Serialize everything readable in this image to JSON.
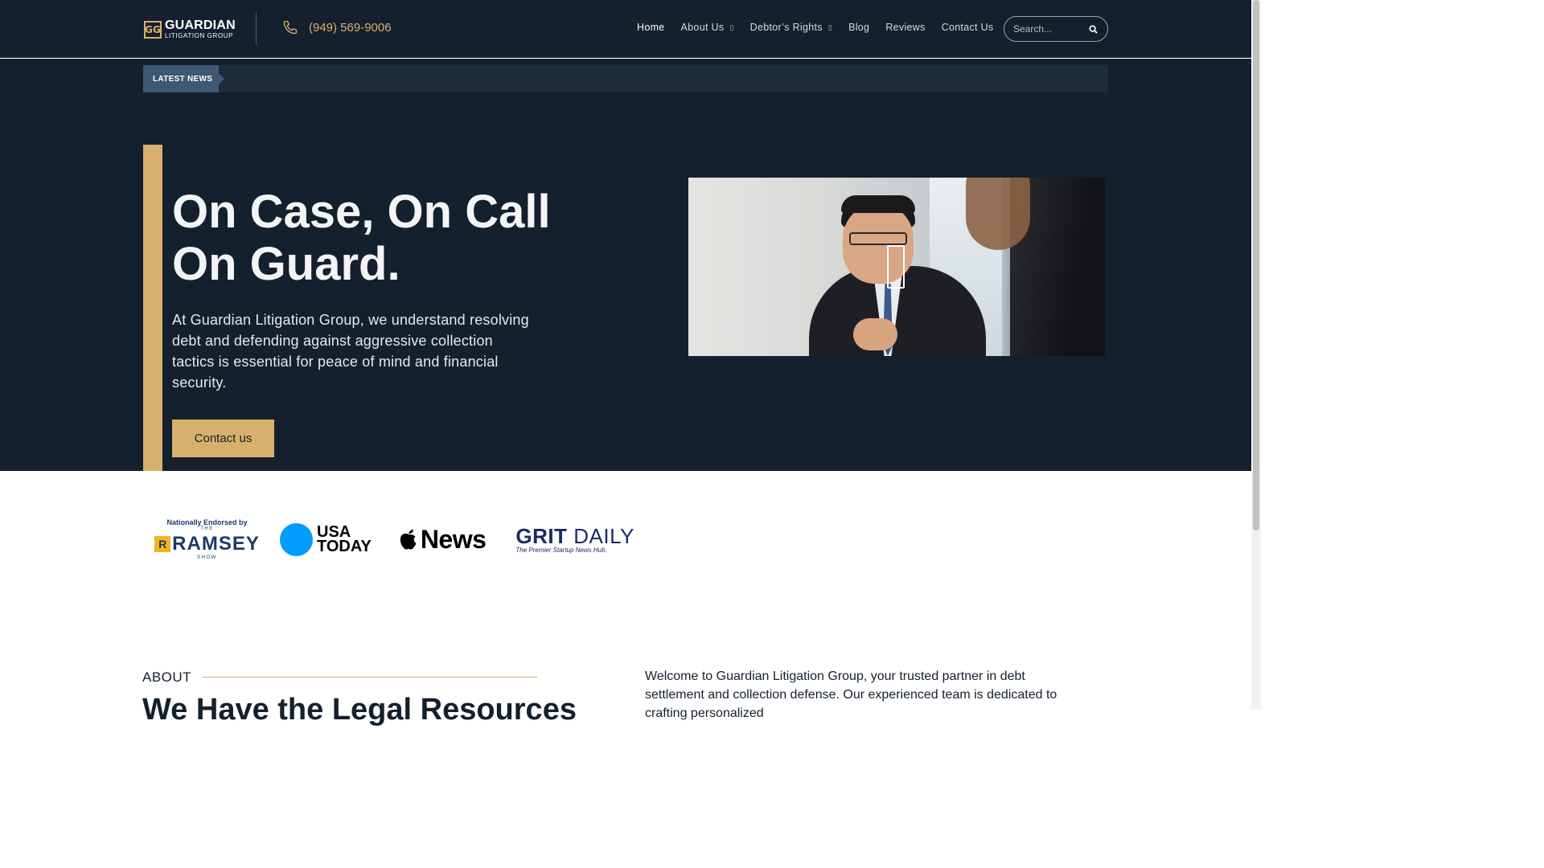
{
  "header": {
    "logo": {
      "mark": "GG",
      "line1": "GUARDIAN",
      "line2": "LITIGATION GROUP"
    },
    "phone": "(949) 569-9006",
    "nav": [
      {
        "label": "Home",
        "dropdown": false
      },
      {
        "label": "About Us",
        "dropdown": true
      },
      {
        "label": "Debtor’s Rights",
        "dropdown": true
      },
      {
        "label": "Blog",
        "dropdown": false
      },
      {
        "label": "Reviews",
        "dropdown": false
      },
      {
        "label": "Contact Us",
        "dropdown": false
      }
    ],
    "search_placeholder": "Search..."
  },
  "news": {
    "label": "LATEST NEWS"
  },
  "hero": {
    "title_line1": "On Case, On Call",
    "title_line2": "On Guard.",
    "text": "At Guardian Litigation Group, we understand resolving debt and defending against aggressive collection tactics is essential for peace of mind and financial security.",
    "cta": "Contact us"
  },
  "press": {
    "ramsey_top": "Nationally Endorsed by",
    "ramsey_the": "THE",
    "ramsey_r": "R",
    "ramsey_word": "RAMSEY",
    "ramsey_show": "SHOW",
    "usa_line1": "USA",
    "usa_line2": "TODAY",
    "apple_news": "News",
    "grit_word1": "GRIT",
    "grit_word2": "DAILY",
    "grit_sub": "The Premier Startup News Hub."
  },
  "about": {
    "label": "ABOUT",
    "heading": "We Have the Legal Resources",
    "text": "Welcome to Guardian Litigation Group, your trusted partner in debt settlement and collection defense. Our experienced team is dedicated to crafting personalized"
  },
  "colors": {
    "navy": "#14202d",
    "gold": "#d7b06e"
  },
  "icons": {
    "phone": "phone-icon",
    "search": "search-icon",
    "play": "play-icon"
  }
}
